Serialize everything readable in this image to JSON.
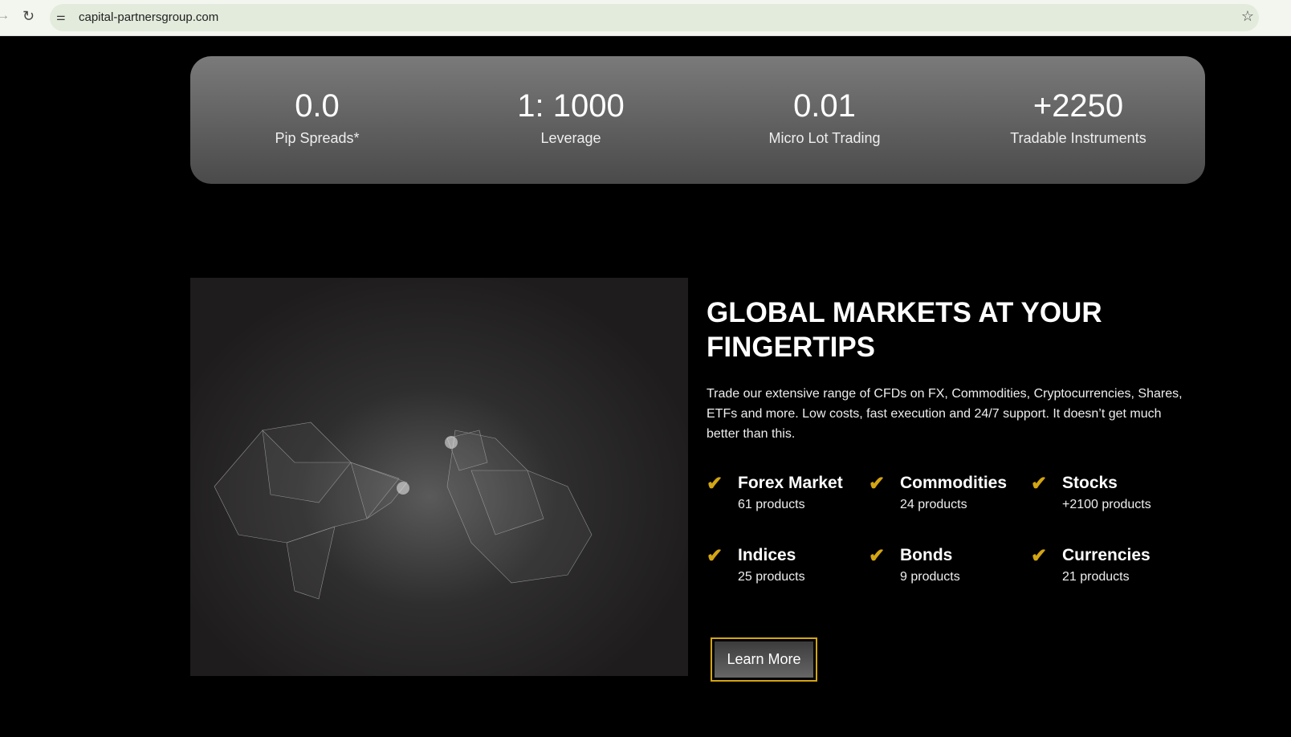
{
  "browser": {
    "url": "capital-partnersgroup.com"
  },
  "stats": [
    {
      "value": "0.0",
      "label": "Pip Spreads*"
    },
    {
      "value": "1: 1000",
      "label": "Leverage"
    },
    {
      "value": "0.01",
      "label": "Micro Lot Trading"
    },
    {
      "value": "+2250",
      "label": "Tradable Instruments"
    }
  ],
  "section": {
    "title": "GLOBAL MARKETS AT YOUR FINGERTIPS",
    "description": "Trade our extensive range of CFDs on FX, Commodities, Cryptocurrencies, Shares, ETFs and more. Low costs, fast execution and 24/7 support. It doesn’t get much better than this.",
    "markets": [
      {
        "name": "Forex Market",
        "count": "61 products"
      },
      {
        "name": "Commodities",
        "count": "24 products"
      },
      {
        "name": "Stocks",
        "count": "+2100 products"
      },
      {
        "name": "Indices",
        "count": "25 products"
      },
      {
        "name": "Bonds",
        "count": "9 products"
      },
      {
        "name": "Currencies",
        "count": "21 products"
      }
    ],
    "cta": "Learn More"
  },
  "colors": {
    "accent": "#d4a514",
    "background": "#000000"
  }
}
